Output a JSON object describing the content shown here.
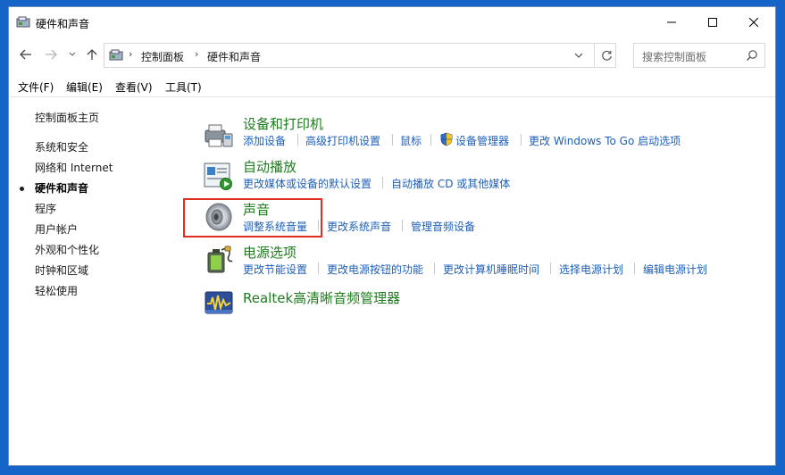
{
  "window": {
    "title": "硬件和声音"
  },
  "address": {
    "crumbs": [
      "控制面板",
      "硬件和声音"
    ],
    "search_placeholder": "搜索控制面板"
  },
  "menu": [
    "文件(F)",
    "编辑(E)",
    "查看(V)",
    "工具(T)"
  ],
  "sidebar": {
    "home": "控制面板主页",
    "items": [
      "系统和安全",
      "网络和 Internet",
      "硬件和声音",
      "程序",
      "用户帐户",
      "外观和个性化",
      "时钟和区域",
      "轻松使用"
    ],
    "active_index": 2
  },
  "categories": [
    {
      "title": "设备和打印机",
      "icon": "printer-icon",
      "tasks": [
        "添加设备",
        "高级打印机设置",
        "鼠标",
        "设备管理器",
        "更改 Windows To Go 启动选项"
      ]
    },
    {
      "title": "自动播放",
      "icon": "autoplay-icon",
      "tasks": [
        "更改媒体或设备的默认设置",
        "自动播放 CD 或其他媒体"
      ]
    },
    {
      "title": "声音",
      "icon": "speaker-icon",
      "tasks": [
        "调整系统音量",
        "更改系统声音",
        "管理音频设备"
      ]
    },
    {
      "title": "电源选项",
      "icon": "power-options-icon",
      "tasks": [
        "更改节能设置",
        "更改电源按钮的功能",
        "更改计算机睡眠时间",
        "选择电源计划",
        "编辑电源计划"
      ]
    },
    {
      "title": "Realtek高清晰音频管理器",
      "icon": "realtek-audio-icon",
      "tasks": []
    }
  ],
  "colors": {
    "category_title": "#1e7c1e",
    "task_link": "#1f5fb8",
    "highlight_box": "#e32b1f",
    "desktop": "#1565c8"
  }
}
